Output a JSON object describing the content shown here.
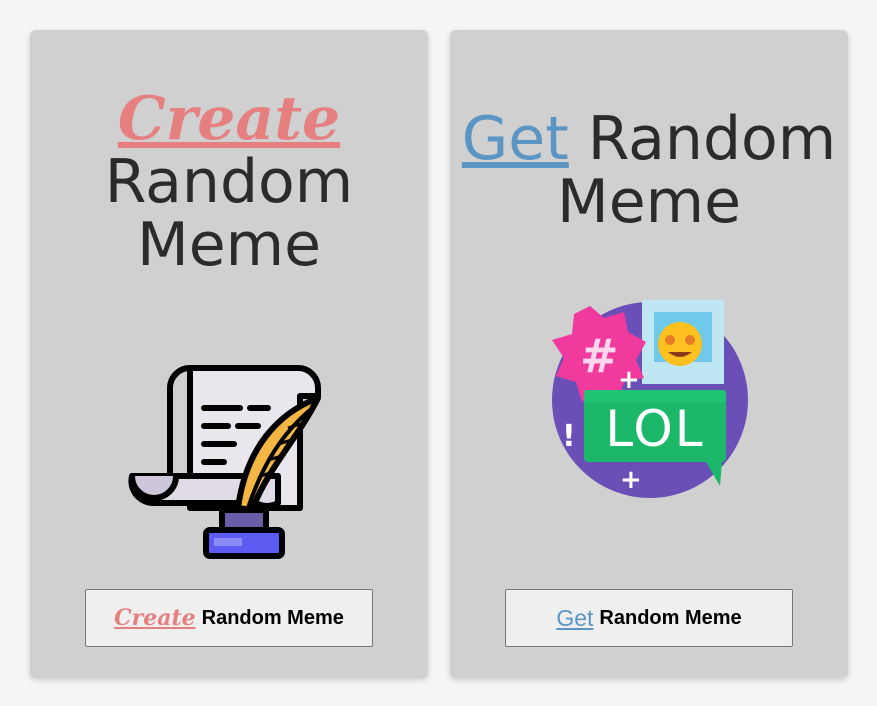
{
  "cards": {
    "create": {
      "title_accent": "Create",
      "title_line1": "Random",
      "title_line2": "Meme",
      "button_accent": "Create",
      "button_label": "Random Meme",
      "icon": "scroll-quill-ink-icon"
    },
    "get": {
      "title_accent": "Get",
      "title_line1": "Random",
      "title_line2": "Meme",
      "button_accent": "Get",
      "button_label": "Random Meme",
      "icon": "social-lol-icon",
      "illustration_text": "LOL"
    }
  },
  "colors": {
    "create_accent": "#e68080",
    "get_accent": "#5a95c4",
    "card_bg": "#d0d0d0"
  }
}
